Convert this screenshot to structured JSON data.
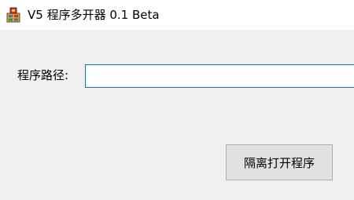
{
  "window": {
    "title": "V5 程序多开器 0.1 Beta",
    "icon": "app-icon"
  },
  "form": {
    "path_label": "程序路径:",
    "path_value": "",
    "open_button_label": "隔离打开程序"
  },
  "colors": {
    "titlebar_bg": "#ffffff",
    "window_bg": "#f0f0f0",
    "input_focus_border": "#0078d7",
    "button_bg": "#e1e1e1",
    "button_border": "#adadad"
  }
}
